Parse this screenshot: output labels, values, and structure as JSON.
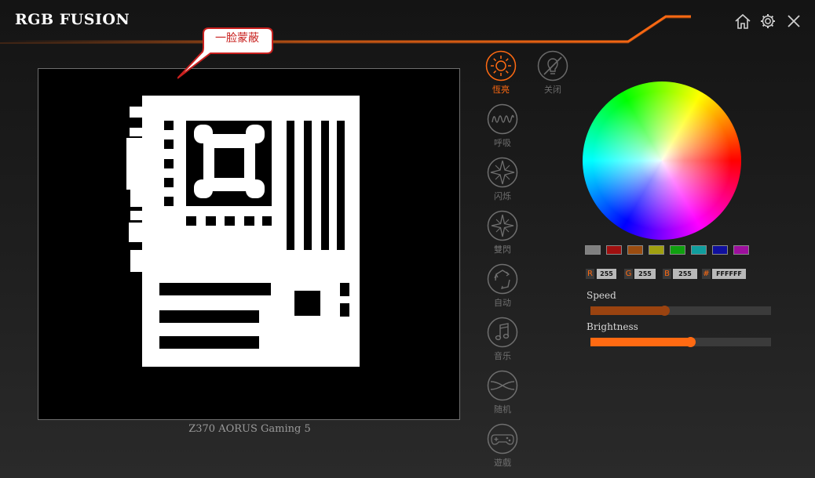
{
  "app": {
    "title": "RGB FUSION"
  },
  "callout": {
    "text": "一脸蒙蔽"
  },
  "preview": {
    "model_name": "Z370 AORUS Gaming 5"
  },
  "modes": [
    {
      "label": "恆亮",
      "icon": "sun-icon",
      "state": "active"
    },
    {
      "label": "关闭",
      "icon": "lightbulb-off-icon",
      "state": "normal"
    },
    {
      "label": "呼吸",
      "icon": "wave-icon",
      "state": "normal"
    },
    {
      "label": "闪烁",
      "icon": "flash-star-icon",
      "state": "normal"
    },
    {
      "label": "雙閃",
      "icon": "double-flash-star-icon",
      "state": "normal"
    },
    {
      "label": "自动",
      "icon": "cycle-arrows-icon",
      "state": "normal"
    },
    {
      "label": "音乐",
      "icon": "music-note-icon",
      "state": "normal"
    },
    {
      "label": "随机",
      "icon": "shuffle-icon",
      "state": "normal"
    },
    {
      "label": "遊戲",
      "icon": "gamepad-icon",
      "state": "normal"
    }
  ],
  "swatches": [
    "#808080",
    "#a01010",
    "#9a4c10",
    "#a0a010",
    "#10a010",
    "#109e9e",
    "#10109e",
    "#9e109e"
  ],
  "rgb": {
    "r_key": "R",
    "r": "255",
    "g_key": "G",
    "g": "255",
    "b_key": "B",
    "b": "255",
    "hex_key": "#",
    "hex": "FFFFFF"
  },
  "sliders": {
    "speed": {
      "label": "Speed",
      "value": 0.41
    },
    "brightness": {
      "label": "Brightness",
      "value": 0.55
    }
  },
  "colors": {
    "accent": "#ff6a12",
    "speed_fill": "#9a4310"
  }
}
